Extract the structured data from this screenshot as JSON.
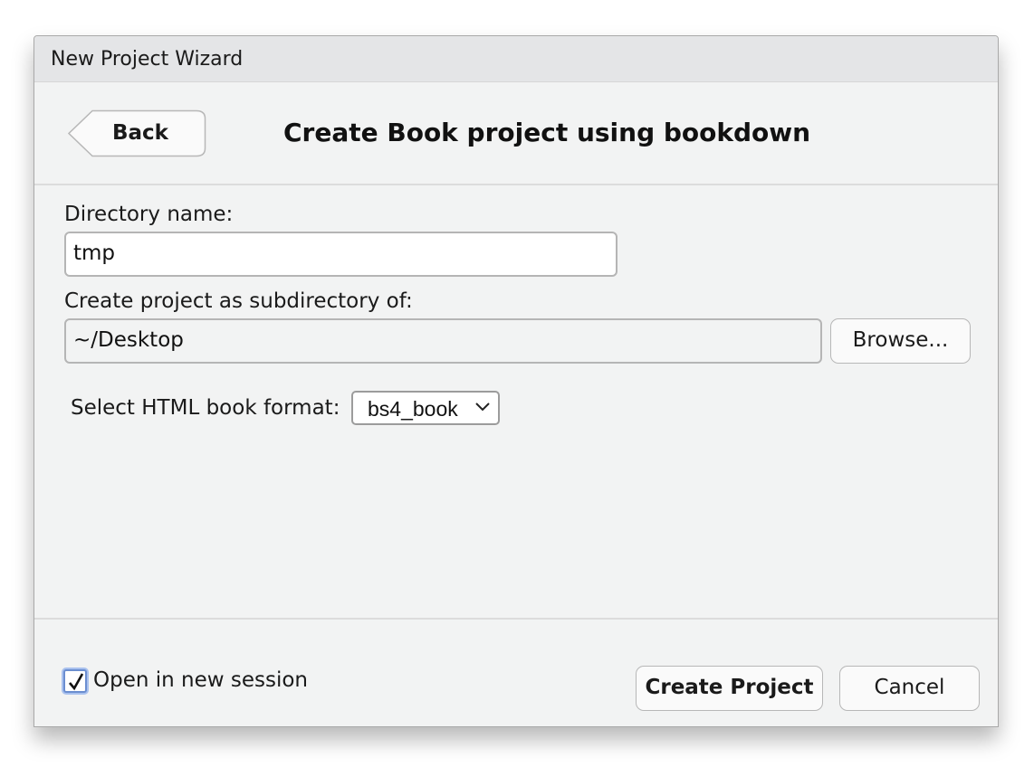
{
  "window": {
    "title": "New Project Wizard"
  },
  "header": {
    "back_label": "Back",
    "heading": "Create Book project using bookdown"
  },
  "form": {
    "directory_label": "Directory name:",
    "directory_value": "tmp",
    "parent_label": "Create project as subdirectory of:",
    "parent_value": "~/Desktop",
    "browse_label": "Browse...",
    "format_label": "Select HTML book format:",
    "format_selected": "bs4_book"
  },
  "footer": {
    "open_new_session_label": "Open in new session",
    "open_new_session_checked": true,
    "create_label": "Create Project",
    "cancel_label": "Cancel"
  },
  "icons": {
    "back": "back-arrow-icon",
    "select": "chevron-down-icon",
    "check": "checkmark-icon"
  },
  "colors": {
    "dialog_bg": "#f2f3f3",
    "titlebar_bg": "#e4e5e7",
    "focus_ring": "#a9c1ee"
  }
}
